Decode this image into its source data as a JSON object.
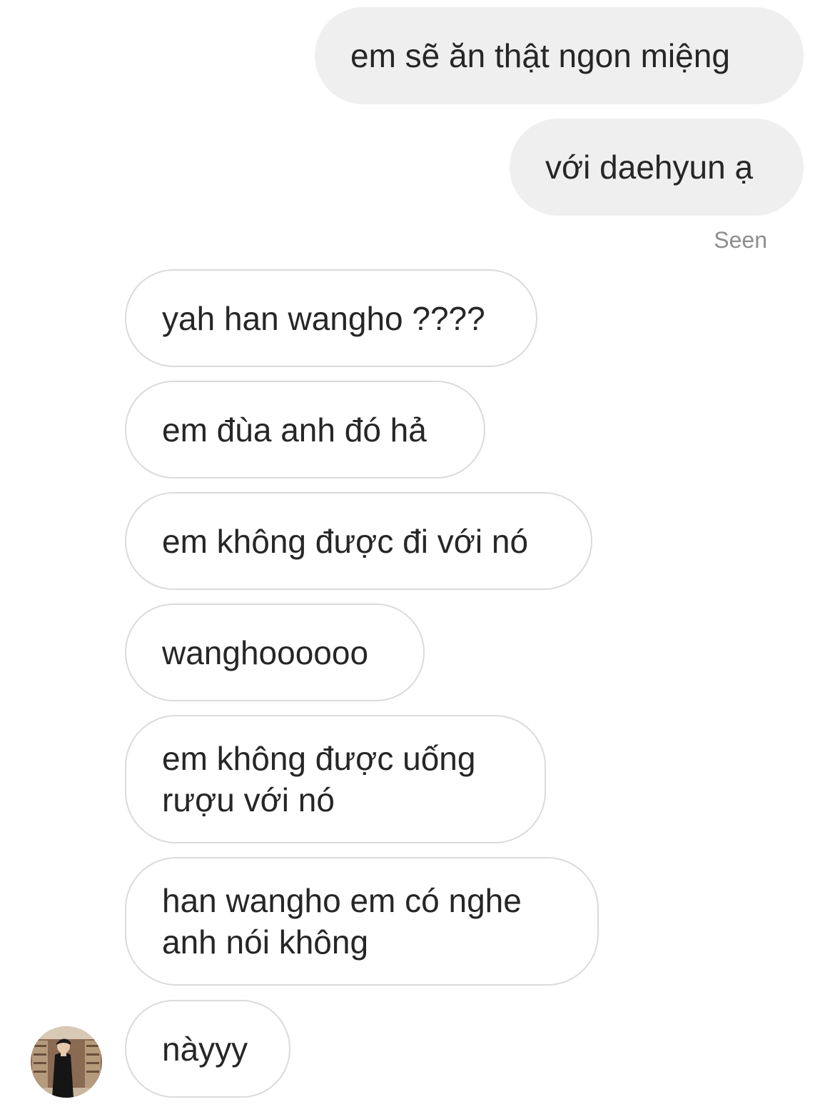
{
  "thread": {
    "sent": [
      "em sẽ ăn thật ngon miệng",
      "với daehyun ạ"
    ],
    "status": "Seen",
    "received": [
      "yah han wangho ????",
      "em đùa anh đó hả",
      "em không được đi với nó",
      "wanghoooooo",
      "em không được uống rượu với nó",
      "han wangho em có nghe anh nói không",
      "nàyyy"
    ]
  },
  "colors": {
    "sent_bubble": "#efefef",
    "received_border": "#dbdbdb",
    "text": "#262626",
    "seen_text": "#8e8e8e"
  },
  "icons": {
    "avatar": "sender-avatar-photo"
  }
}
